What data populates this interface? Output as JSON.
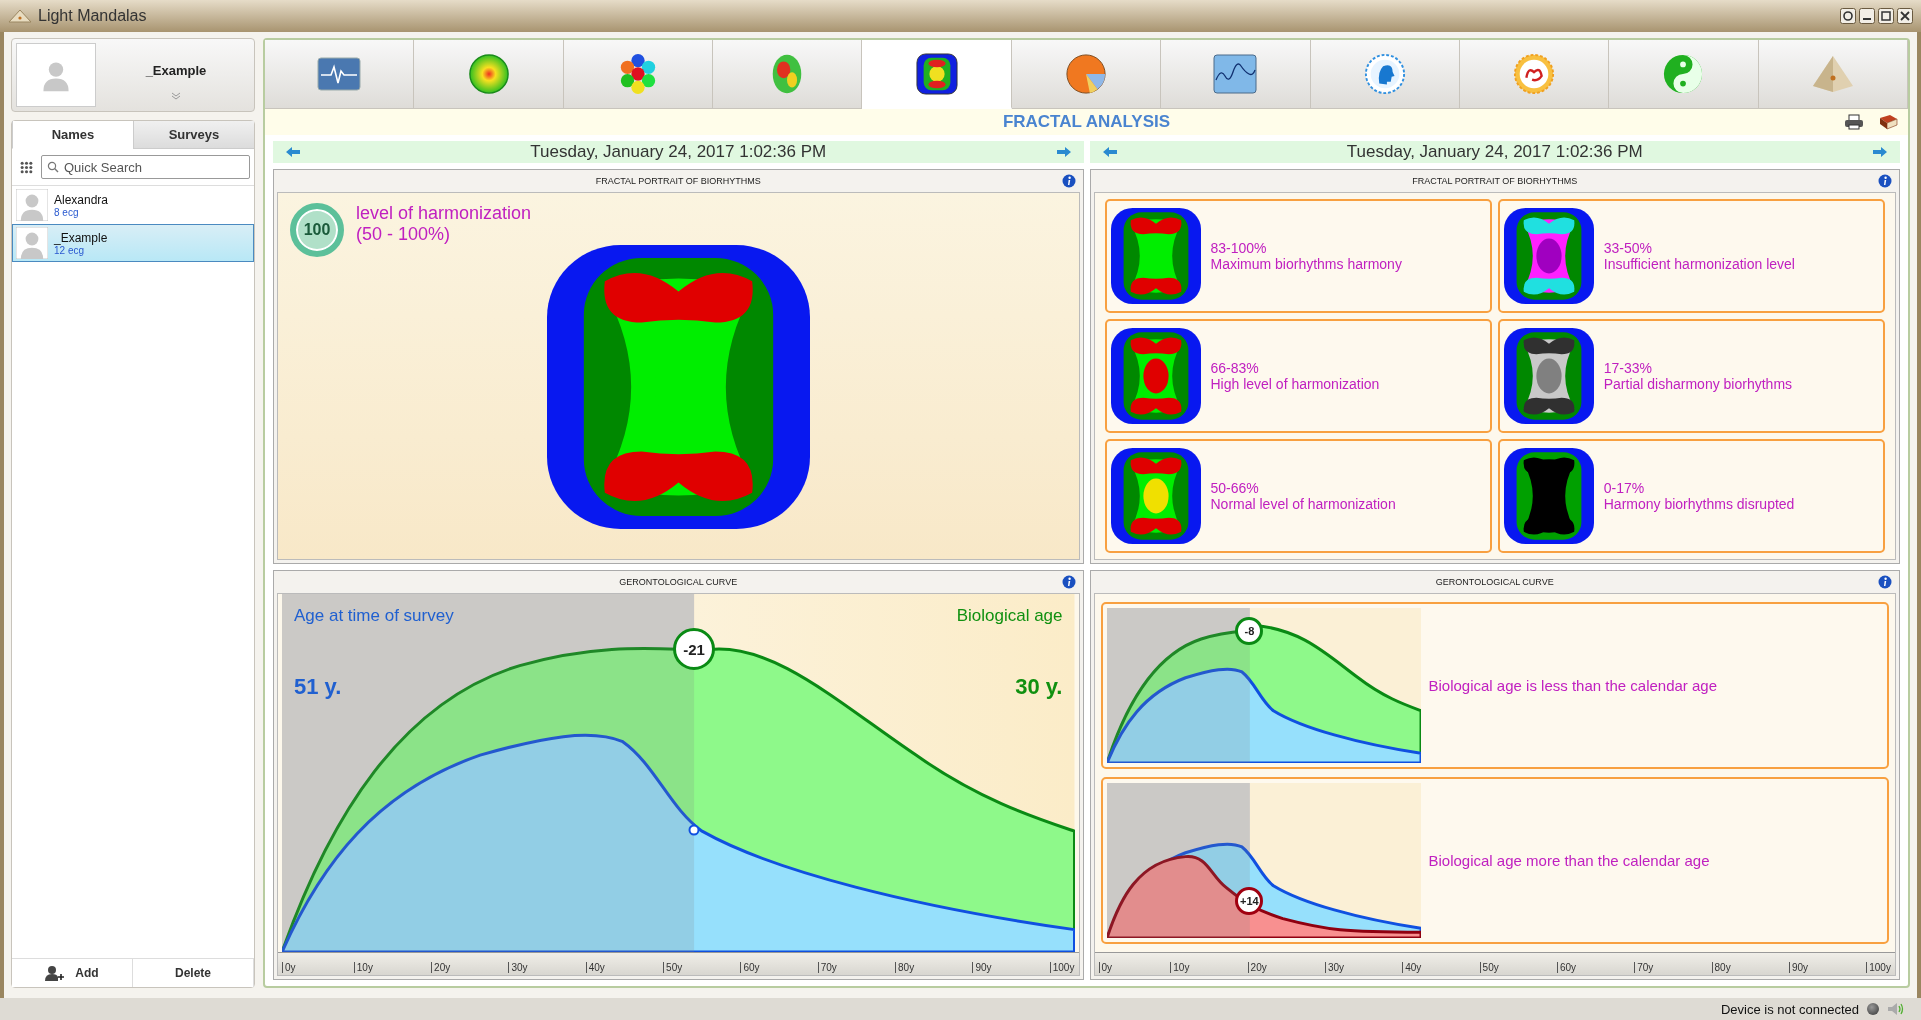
{
  "window": {
    "title": "Light Mandalas"
  },
  "profile": {
    "name": "_Example"
  },
  "sidebar_tabs": [
    {
      "label": "Names",
      "selected": true
    },
    {
      "label": "Surveys",
      "selected": false
    }
  ],
  "search": {
    "placeholder": "Quick Search"
  },
  "people": [
    {
      "name": "Alexandra",
      "count": "8 ecg",
      "selected": false
    },
    {
      "name": "_Example",
      "count": "12 ecg",
      "selected": true
    }
  ],
  "sidebar_buttons": [
    {
      "label": "Add",
      "kind": "add"
    },
    {
      "label": "Delete",
      "kind": "plain"
    }
  ],
  "toolbar": [
    {
      "kind": "monitor",
      "selected": false
    },
    {
      "kind": "orb",
      "selected": false
    },
    {
      "kind": "hexagons",
      "selected": false
    },
    {
      "kind": "brain",
      "selected": false
    },
    {
      "kind": "fractal",
      "selected": true
    },
    {
      "kind": "pie",
      "selected": false
    },
    {
      "kind": "graph",
      "selected": false
    },
    {
      "kind": "head",
      "selected": false
    },
    {
      "kind": "sun",
      "selected": false
    },
    {
      "kind": "yinyang",
      "selected": false
    },
    {
      "kind": "pyramid",
      "selected": false
    }
  ],
  "section_title": "FRACTAL ANALYSIS",
  "left": {
    "date": "Tuesday, January 24, 2017 1:02:36 PM",
    "portrait": {
      "title": "FRACTAL PORTRAIT OF BIORHYTHMS",
      "score": "100",
      "label": "level of harmonization",
      "range": "(50 - 100%)",
      "kind": "max"
    },
    "curve": {
      "title": "GERONTOLOGICAL CURVE",
      "age_label": "Age at time of survey",
      "bio_label": "Biological age",
      "age_value": "51 y.",
      "bio_value": "30 y.",
      "marker": "-21",
      "axis": [
        "0y",
        "10y",
        "20y",
        "30y",
        "40y",
        "50y",
        "60y",
        "70y",
        "80y",
        "90y",
        "100y"
      ]
    }
  },
  "right": {
    "date": "Tuesday, January 24, 2017 1:02:36 PM",
    "legend": {
      "title": "FRACTAL PORTRAIT OF BIORHYTHMS",
      "items": [
        {
          "range": "83-100%",
          "text": "Maximum biorhythms harmony",
          "kind": "max"
        },
        {
          "range": "33-50%",
          "text": "Insufficient harmonization level",
          "kind": "insufficient"
        },
        {
          "range": "66-83%",
          "text": "High level of harmonization",
          "kind": "high"
        },
        {
          "range": "17-33%",
          "text": "Partial disharmony biorhythms",
          "kind": "partial"
        },
        {
          "range": "50-66%",
          "text": "Normal level of harmonization",
          "kind": "normal"
        },
        {
          "range": "0-17%",
          "text": "Harmony biorhythms disrupted",
          "kind": "disrupted"
        }
      ]
    },
    "curves": {
      "title": "GERONTOLOGICAL CURVE",
      "items": [
        {
          "kind": "less",
          "marker": "-8",
          "text": "Biological age is less than the calendar age"
        },
        {
          "kind": "more",
          "marker": "+14",
          "text": "Biological age more than the calendar age"
        }
      ],
      "axis": [
        "0y",
        "10y",
        "20y",
        "30y",
        "40y",
        "50y",
        "60y",
        "70y",
        "80y",
        "90y",
        "100y"
      ]
    }
  },
  "status": {
    "text": "Device is not connected"
  }
}
